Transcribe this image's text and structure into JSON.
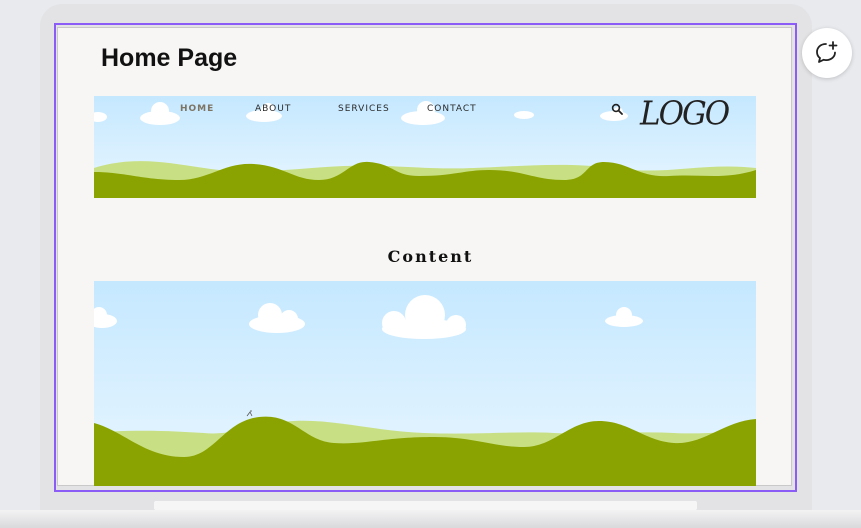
{
  "page": {
    "title": "Home Page"
  },
  "nav": {
    "items": [
      {
        "label": "HOME",
        "active": true
      },
      {
        "label": "ABOUT",
        "active": false
      },
      {
        "label": "SERVICES",
        "active": false
      },
      {
        "label": "CONTACT",
        "active": false
      }
    ],
    "search_icon": "search-icon"
  },
  "logo": {
    "text": "LOGO"
  },
  "content": {
    "heading": "Content"
  },
  "colors": {
    "selection_border": "#8b5cf6",
    "sky_top": "#c5e8ff",
    "hill_dark": "#8aa300",
    "hill_light": "#c8e083",
    "nav_active": "#7d7464"
  },
  "toolbar": {
    "comment_icon": "add-comment-icon"
  }
}
